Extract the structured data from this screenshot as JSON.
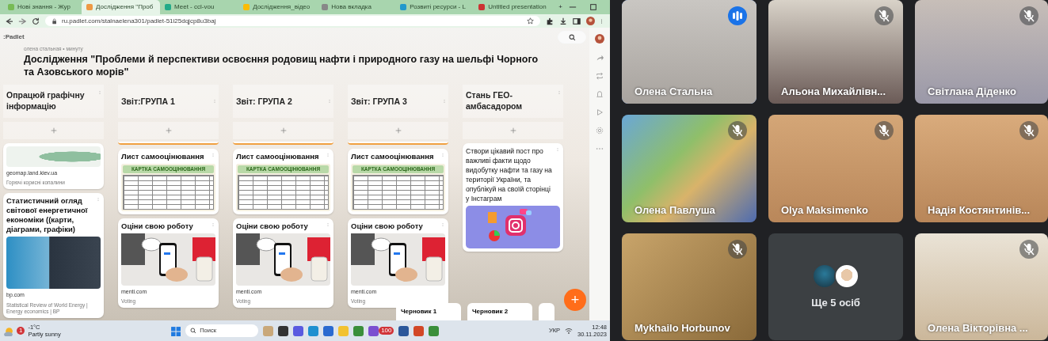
{
  "browser": {
    "tabs": [
      {
        "title": "Нові знання - Жур",
        "selected": false
      },
      {
        "title": "Дослідження \"Проб",
        "selected": true
      },
      {
        "title": "Meet - ccl-vou",
        "selected": false
      },
      {
        "title": "Дослідження_відео",
        "selected": false
      },
      {
        "title": "Нова вкладка",
        "selected": false
      },
      {
        "title": "Розвиті ресурси - L",
        "selected": false
      },
      {
        "title": "Untitled presentation",
        "selected": false
      }
    ],
    "new_tab": "+",
    "url": "ru.padlet.com/stalnaelena301/padlet-51i25dqjcp8u3baj"
  },
  "padlet": {
    "logo": ":Padlet",
    "author": "олена стальная • минуту",
    "title": "Дослідження \"Проблеми й перспективи освоєння родовищ нафти і природного газу на шельфі Чорного та Азовського морів\"",
    "columns": [
      {
        "title": "Опрацюй графічну інформацію",
        "cards": [
          {
            "kind": "map_link",
            "source": "geomap.land.kiev.ua",
            "caption": "Горючі корисні копалини"
          },
          {
            "kind": "photo_link",
            "title": "Статистичний огляд світової енергетичної економіки ((карти, діаграми, графіки)",
            "source": "bp.com",
            "caption": "Statistical Review of World Energy | Energy economics | BP"
          }
        ]
      },
      {
        "title": "Звіт:ГРУПА 1",
        "cards": [
          {
            "kind": "sheet",
            "title": "Лист самооцінювання",
            "sheet_title": "КАРТКА САМООЦІНЮВАННЯ"
          },
          {
            "kind": "phone_link",
            "title": "Оціни свою роботу",
            "source": "menti.com",
            "caption": "Voting"
          }
        ]
      },
      {
        "title": "Звіт: ГРУПА 2",
        "cards": [
          {
            "kind": "sheet",
            "title": "Лист самооцінювання",
            "sheet_title": "КАРТКА САМООЦІНЮВАННЯ"
          },
          {
            "kind": "phone_link",
            "title": "Оціни свою роботу",
            "source": "menti.com",
            "caption": "Voting"
          }
        ]
      },
      {
        "title": "Звіт: ГРУПА 3",
        "cards": [
          {
            "kind": "sheet",
            "title": "Лист самооцінювання",
            "sheet_title": "КАРТКА САМООЦІНЮВАННЯ"
          },
          {
            "kind": "phone_link",
            "title": "Оціни свою роботу",
            "source": "menti.com",
            "caption": "Voting"
          }
        ]
      },
      {
        "title": "Стань ГЕО-амбасадором",
        "cards": [
          {
            "kind": "text",
            "body": "Створи цікавий пост про важливі факти щодо видобутку нафти та газу на території України, та опублікуй на своїй сторінці у Інстаграм"
          }
        ]
      }
    ],
    "drafts": [
      "Черновик 1",
      "Черновик 2"
    ],
    "add": "+"
  },
  "taskbar": {
    "weather_badge": "1",
    "temperature": "-1°C",
    "weather": "Partly sunny",
    "search": "Поиск",
    "app_badge": "100",
    "language": "УКР",
    "time": "12:48",
    "date": "30.11.2023"
  },
  "participants": [
    {
      "kind": "video",
      "name": "Олена Стальна",
      "muted": false,
      "speaking": true
    },
    {
      "kind": "video",
      "name": "Альона Михайлівн...",
      "muted": true,
      "speaking": false
    },
    {
      "kind": "video",
      "name": "Світлана Діденко",
      "muted": true,
      "speaking": false
    },
    {
      "kind": "video",
      "name": "Олена Павлуша",
      "muted": true,
      "speaking": false
    },
    {
      "kind": "video",
      "name": "Olya Maksimenko",
      "muted": true,
      "speaking": false
    },
    {
      "kind": "video",
      "name": "Надія Костянтинів...",
      "muted": true,
      "speaking": false
    },
    {
      "kind": "video",
      "name": "Mykhailo Horbunov",
      "muted": true,
      "speaking": false
    },
    {
      "kind": "others",
      "label": "Ще 5 осіб",
      "avatars": [
        {
          "kind": "cartoon"
        },
        {
          "kind": "photo"
        }
      ]
    },
    {
      "kind": "video",
      "name": "Олена Вікторівна ...",
      "muted": true,
      "speaking": false
    }
  ]
}
